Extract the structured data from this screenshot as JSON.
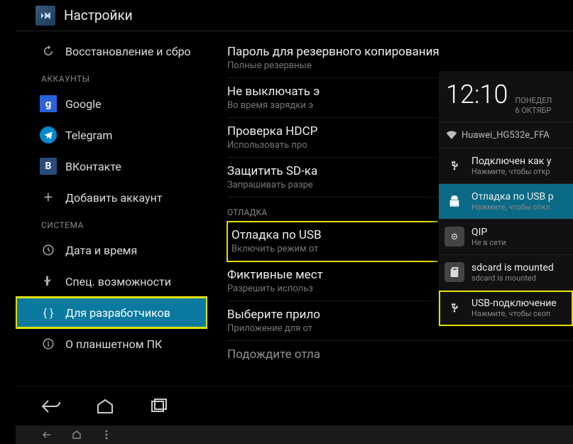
{
  "header": {
    "title": "Настройки"
  },
  "sidebar": {
    "restore": "Восстановление и сбро",
    "section_accounts": "АККАУНТЫ",
    "accounts": [
      {
        "label": "Google",
        "icon": "google"
      },
      {
        "label": "Telegram",
        "icon": "telegram"
      },
      {
        "label": "ВКонтакте",
        "icon": "vk"
      },
      {
        "label": "Добавить аккаунт",
        "icon": "plus"
      }
    ],
    "section_system": "СИСТЕМА",
    "system": [
      {
        "label": "Дата и время",
        "icon": "clock"
      },
      {
        "label": "Спец. возможности",
        "icon": "hand"
      },
      {
        "label": "Для разработчиков",
        "icon": "braces",
        "active": true,
        "highlight": true
      },
      {
        "label": "О планшетном ПК",
        "icon": "info"
      }
    ]
  },
  "settings": [
    {
      "main": "Пароль для резервного копирования",
      "sub": "Полные резервные"
    },
    {
      "main": "Не выключать э",
      "sub": "Во время зарядки э"
    },
    {
      "main": "Проверка HDCP",
      "sub": "Использовать про"
    },
    {
      "main": "Защитить SD-ка",
      "sub": "Запрашивать разре"
    }
  ],
  "section_debug": "ОТЛАДКА",
  "debug_settings": [
    {
      "main": "Отладка по USB",
      "sub": "Включить режим от",
      "highlight": true
    },
    {
      "main": "Фиктивные мест",
      "sub": "Разрешить использ"
    },
    {
      "main": "Выберите прило",
      "sub": "Приложение для от"
    },
    {
      "main": "Подождите отла",
      "sub": ""
    }
  ],
  "notif": {
    "time": "12:10",
    "day": "ПОНЕДЕЛ",
    "date": "6 ОКТЯБР",
    "wifi": "Huawei_HG532e_FFA",
    "items": [
      {
        "t1": "Подключен как у",
        "t2": "Нажмите, чтобы откр",
        "icon": "usb"
      },
      {
        "t1": "Отладка по USB р",
        "t2": "Нажмите, чтобы откл",
        "icon": "android",
        "active": true
      },
      {
        "t1": "QIP",
        "t2": "Не в сети",
        "icon": "qip"
      },
      {
        "t1": "sdcard is mounted",
        "t2": "sdcard is mounted",
        "icon": "sdcard"
      },
      {
        "t1": "USB-подключение",
        "t2": "Нажмите, чтобы скоп",
        "icon": "usb",
        "highlight": true
      }
    ]
  }
}
